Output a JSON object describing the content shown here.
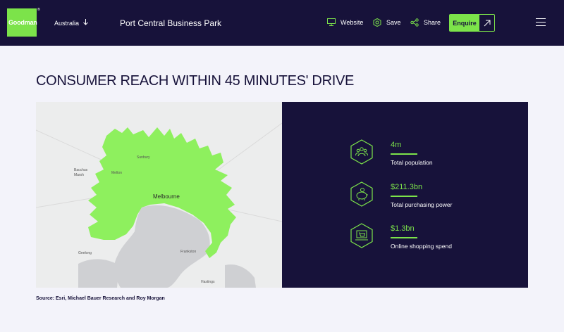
{
  "header": {
    "logo_text": "Goodman",
    "logo_mark": "®",
    "country": "Australia",
    "property_title": "Port Central Business Park",
    "nav": {
      "website": "Website",
      "save": "Save",
      "share": "Share"
    },
    "enquire_label": "Enquire"
  },
  "section": {
    "title": "CONSUMER REACH WITHIN 45 MINUTES' DRIVE"
  },
  "map": {
    "labels": {
      "sunbury": "Sunbury",
      "bacchus_marsh": "Bacchus\nMarsh",
      "melton": "Melton",
      "melbourne": "Melbourne",
      "geelong": "Geelong",
      "frankston": "Frankston",
      "hastings": "Hastings"
    },
    "colors": {
      "land": "#eceded",
      "water": "#cfd0d3",
      "reach": "#8ef05e"
    }
  },
  "stats": [
    {
      "value": "4m",
      "label": "Total population",
      "icon": "people-icon"
    },
    {
      "value": "$211.3bn",
      "label": "Total purchasing power",
      "icon": "piggy-bank-icon"
    },
    {
      "value": "$1.3bn",
      "label": "Online shopping spend",
      "icon": "shopping-cart-icon"
    }
  ],
  "source": "Source: Esri, Michael Bauer Research and Roy Morgan",
  "colors": {
    "navy": "#17123a",
    "green": "#7ce34a",
    "background": "#f3f3fa"
  }
}
